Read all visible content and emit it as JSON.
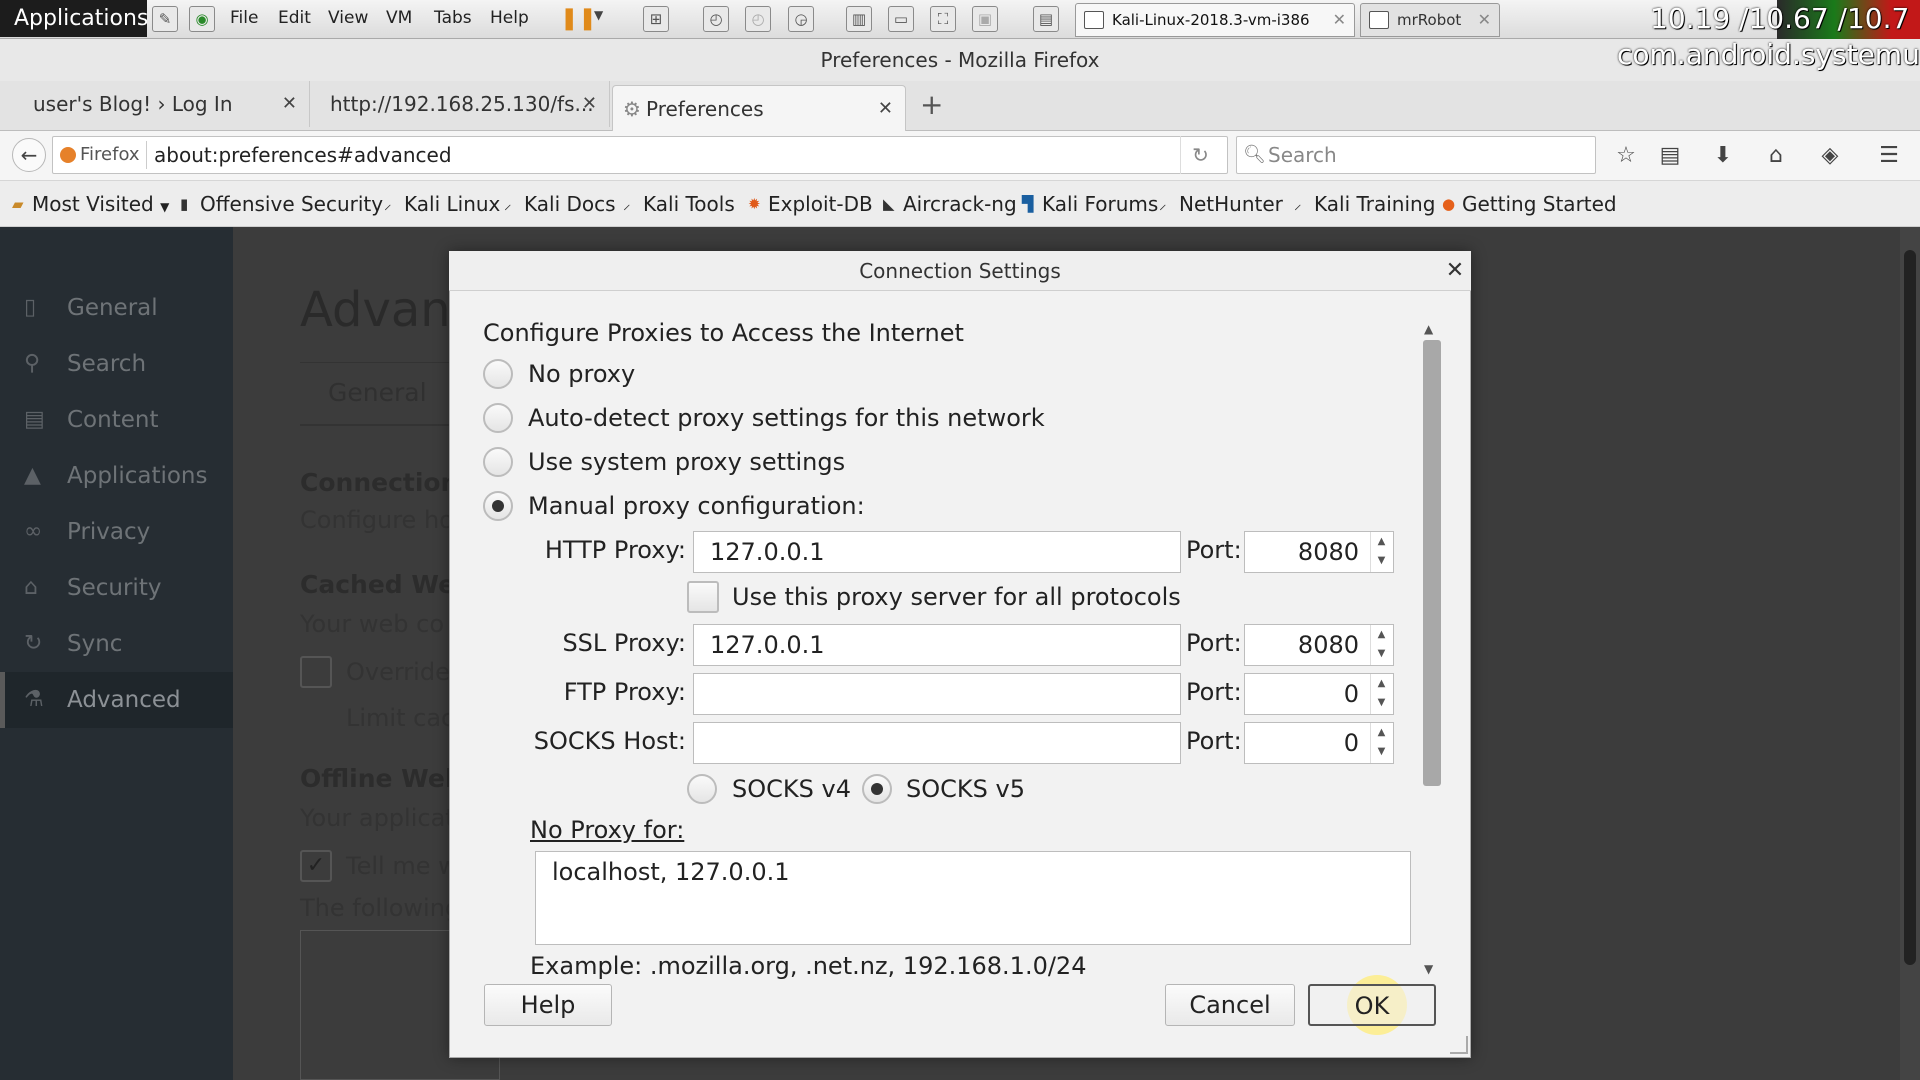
{
  "vm": {
    "apps_label": "Applications",
    "menus": [
      "File",
      "Edit",
      "View",
      "VM",
      "Tabs",
      "Help"
    ],
    "tabs": [
      {
        "label": "Kali-Linux-2018.3-vm-i386",
        "active": true
      },
      {
        "label": "mrRobot",
        "active": false
      }
    ],
    "overlay_top": "10.19 /10.67 /10.7",
    "overlay_bottom": "com.android.systemui"
  },
  "firefox": {
    "window_title": "Preferences - Mozilla Firefox",
    "tabs": [
      {
        "label": "user's Blog! › Log In"
      },
      {
        "label": "http://192.168.25.130/fs..."
      },
      {
        "label": "Preferences"
      }
    ],
    "new_tab": "+",
    "identity": "Firefox",
    "url": "about:preferences#advanced",
    "search_placeholder": "Search",
    "bookmarks": [
      {
        "label": "Most Visited",
        "icon": "folder-icon"
      },
      {
        "label": "Offensive Security",
        "icon": "offsec-icon"
      },
      {
        "label": "Kali Linux",
        "icon": "kali-icon"
      },
      {
        "label": "Kali Docs",
        "icon": "kali-icon"
      },
      {
        "label": "Kali Tools",
        "icon": "kali-icon"
      },
      {
        "label": "Exploit-DB",
        "icon": "exploit-db-icon"
      },
      {
        "label": "Aircrack-ng",
        "icon": "aircrack-icon"
      },
      {
        "label": "Kali Forums",
        "icon": "kali-forums-icon"
      },
      {
        "label": "NetHunter",
        "icon": "kali-icon"
      },
      {
        "label": "Kali Training",
        "icon": "kali-icon"
      },
      {
        "label": "Getting Started",
        "icon": "firefox-icon"
      }
    ]
  },
  "prefs": {
    "sidebar": [
      {
        "label": "General",
        "icon": "general-icon"
      },
      {
        "label": "Search",
        "icon": "search-icon"
      },
      {
        "label": "Content",
        "icon": "content-icon"
      },
      {
        "label": "Applications",
        "icon": "applications-icon"
      },
      {
        "label": "Privacy",
        "icon": "privacy-icon"
      },
      {
        "label": "Security",
        "icon": "security-icon"
      },
      {
        "label": "Sync",
        "icon": "sync-icon"
      },
      {
        "label": "Advanced",
        "icon": "advanced-icon",
        "active": true
      }
    ],
    "page_heading": "Advanc",
    "subtab": "General",
    "connection_heading": "Connection",
    "connection_desc": "Configure ho",
    "cached_heading": "Cached Web",
    "cached_desc": "Your web co",
    "override_label": "Override",
    "limit_label": "Limit cac",
    "offline_heading": "Offline Web",
    "offline_desc": "Your applicat",
    "tell_me_label": "Tell me w",
    "following_label": "The following"
  },
  "dialog": {
    "title": "Connection Settings",
    "heading": "Configure Proxies to Access the Internet",
    "options": [
      {
        "label": "No proxy",
        "selected": false
      },
      {
        "label": "Auto-detect proxy settings for this network",
        "selected": false
      },
      {
        "label": "Use system proxy settings",
        "selected": false
      },
      {
        "label": "Manual proxy configuration:",
        "selected": true
      }
    ],
    "http_label": "HTTP Proxy:",
    "http_value": "127.0.0.1",
    "http_port_label": "Port:",
    "http_port": "8080",
    "all_protocols_label": "Use this proxy server for all protocols",
    "all_protocols_checked": false,
    "ssl_label": "SSL Proxy:",
    "ssl_value": "127.0.0.1",
    "ssl_port_label": "Port:",
    "ssl_port": "8080",
    "ftp_label": "FTP Proxy:",
    "ftp_value": "",
    "ftp_port_label": "Port:",
    "ftp_port": "0",
    "socks_label": "SOCKS Host:",
    "socks_value": "",
    "socks_port_label": "Port:",
    "socks_port": "0",
    "socks_v4_label": "SOCKS v4",
    "socks_v5_label": "SOCKS v5",
    "socks_version_selected": "SOCKS v5",
    "no_proxy_label": "No Proxy for:",
    "no_proxy_value": "localhost, 127.0.0.1",
    "example_text": "Example: .mozilla.org, .net.nz, 192.168.1.0/24",
    "help_label": "Help",
    "cancel_label": "Cancel",
    "ok_label": "OK"
  }
}
